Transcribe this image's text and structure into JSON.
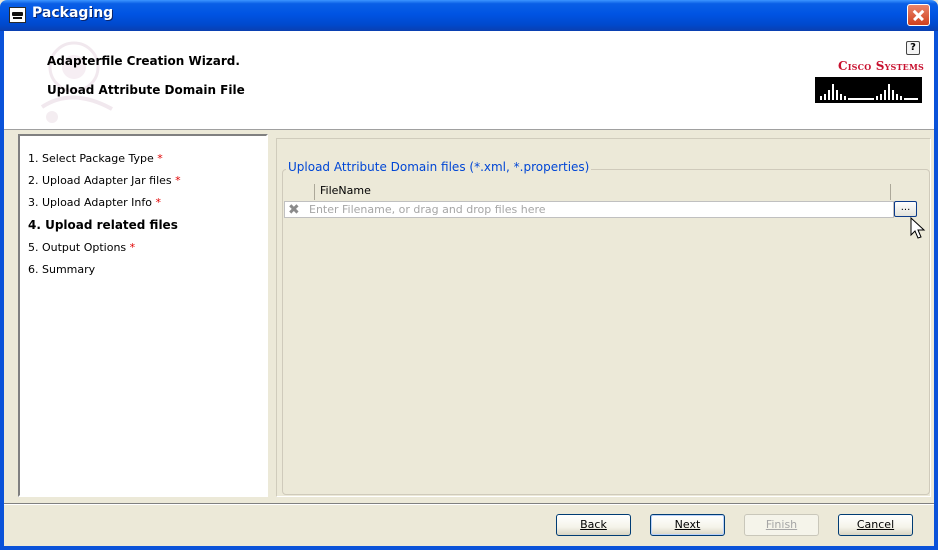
{
  "window": {
    "title": "Packaging"
  },
  "header": {
    "wizard_title": "Adapterfile Creation Wizard.",
    "step_title": "Upload Attribute Domain File",
    "help_label": "?",
    "logo_text": "Cisco Systems"
  },
  "steps": {
    "items": [
      {
        "label": "1. Select Package Type",
        "required": "*"
      },
      {
        "label": "2. Upload Adapter Jar files",
        "required": "*"
      },
      {
        "label": "3. Upload Adapter Info",
        "required": "*"
      },
      {
        "label": "4. Upload related files",
        "required": ""
      },
      {
        "label": "5. Output Options",
        "required": "*"
      },
      {
        "label": "6. Summary",
        "required": ""
      }
    ],
    "current_index": 3
  },
  "upload": {
    "group_label": "Upload Attribute Domain files (*.xml, *.properties)",
    "column_header": "FileName",
    "input_placeholder": "Enter Filename, or drag and drop files here",
    "browse_label": "..."
  },
  "footer": {
    "back_label": "Back",
    "next_label": "Next",
    "finish_label": "Finish",
    "cancel_label": "Cancel",
    "finish_enabled": false
  },
  "colors": {
    "title_bar": "#0054e3",
    "group_label": "#0046d5",
    "required_mark": "#e00000",
    "logo_red": "#c8102e"
  },
  "icons": {
    "app": "packaging-window-icon",
    "close": "close-icon",
    "help": "help-icon",
    "remove": "remove-file-icon",
    "cursor": "mouse-pointer-icon"
  }
}
